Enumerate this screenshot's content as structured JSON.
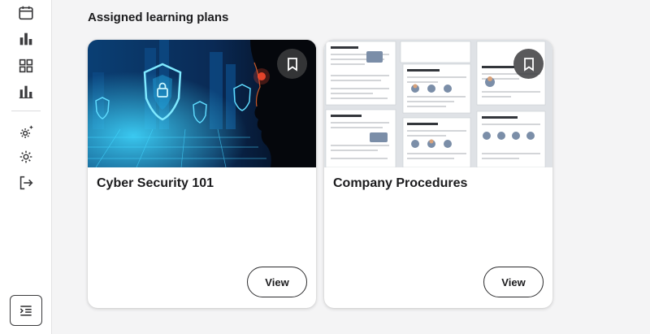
{
  "sidebar": {
    "icons": [
      "calendar-icon",
      "bar-chart-icon",
      "grid-icon",
      "stats-icon",
      "gear-sparkle-icon",
      "settings-icon",
      "logout-icon"
    ],
    "collapse_icon": "indent-toggle-icon"
  },
  "main": {
    "section_title": "Assigned learning plans",
    "cards": [
      {
        "title": "Cyber Security 101",
        "view_label": "View",
        "image": "cyber-security-shield-image"
      },
      {
        "title": "Company Procedures",
        "view_label": "View",
        "image": "company-procedures-document-image"
      }
    ]
  },
  "colors": {
    "background": "#f4f4f5",
    "card": "#ffffff",
    "text": "#1c1c1e",
    "cyber_accent": "#2ec5ff",
    "bookmark_bg": "#3c3c3e"
  }
}
